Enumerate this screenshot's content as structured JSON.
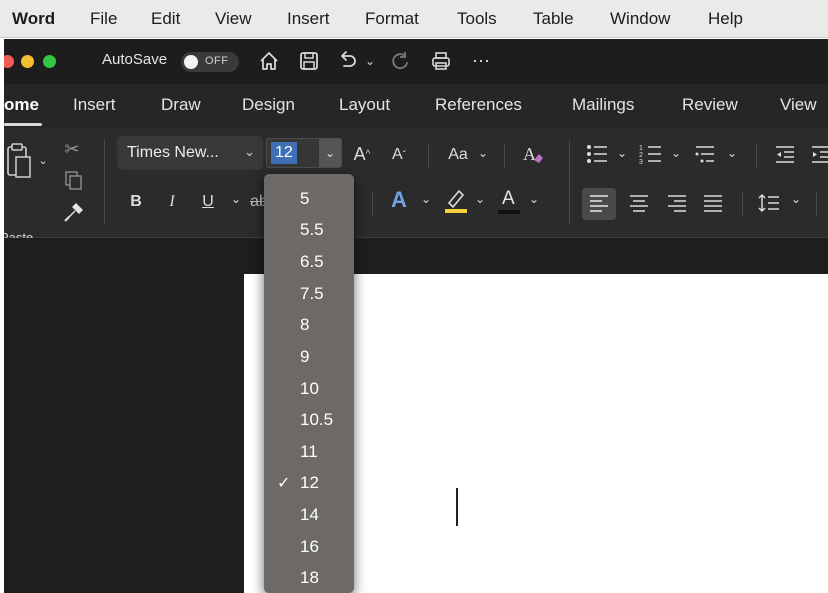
{
  "menubar": {
    "items": [
      "Word",
      "File",
      "Edit",
      "View",
      "Insert",
      "Format",
      "Tools",
      "Table",
      "Window",
      "Help"
    ]
  },
  "titlebar": {
    "autosave_label": "AutoSave",
    "autosave_state": "OFF",
    "icons": [
      "home-icon",
      "save-icon",
      "undo-icon",
      "redo-icon",
      "print-icon",
      "more-icon"
    ]
  },
  "ribbon_tabs": [
    "ome",
    "Insert",
    "Draw",
    "Design",
    "Layout",
    "References",
    "Mailings",
    "Review",
    "View"
  ],
  "ribbon": {
    "paste_label": "Paste",
    "font_name": "Times New...",
    "font_size": "12",
    "change_case_label": "Aa",
    "grow_font_label": "A",
    "shrink_font_label": "A",
    "bold": "B",
    "italic": "I",
    "underline": "U",
    "text_effects": "A",
    "font_color": "A"
  },
  "font_size_dropdown": {
    "selected": "12",
    "options": [
      "5",
      "5.5",
      "6.5",
      "7.5",
      "8",
      "9",
      "10",
      "10.5",
      "11",
      "12",
      "14",
      "16",
      "18"
    ]
  },
  "colors": {
    "window_bg": "#1f1f1f",
    "ribbon_bg": "#2b2b2b",
    "dropdown_bg": "#6c6966",
    "selection_blue": "#3f6fb5",
    "highlight_yellow": "#f2d13a",
    "traffic_red": "#f35c53",
    "traffic_yellow": "#f5bd32",
    "traffic_green": "#2fc840"
  }
}
